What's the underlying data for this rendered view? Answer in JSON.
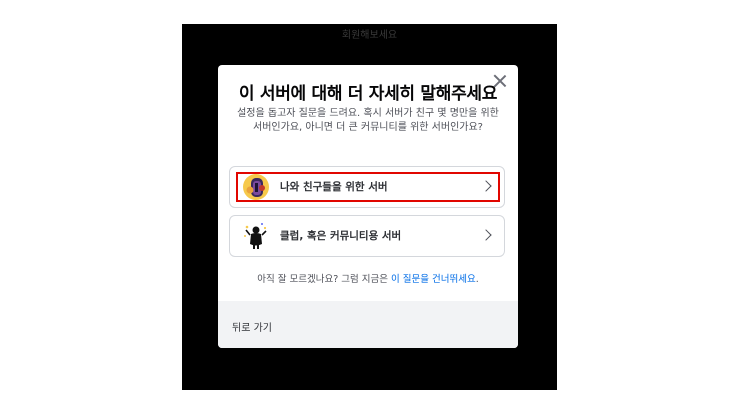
{
  "background": {
    "title": "회원해보세요"
  },
  "modal": {
    "title": "이 서버에 대해 더 자세히 말해주세요",
    "description": "설정을 돕고자 질문을 드려요. 혹시 서버가 친구 몇 명만을 위한 서버인가요, 아니면 더 큰 커뮤니티를 위한 서버인가요?",
    "options": [
      {
        "label": "나와 친구들을 위한 서버",
        "icon": "friends-icon",
        "highlighted": true
      },
      {
        "label": "클럽, 혹은 커뮤니티용 서버",
        "icon": "community-icon",
        "highlighted": false
      }
    ],
    "skip_prefix": "아직 잘 모르겠나요? 그럼 지금은 ",
    "skip_link": "이 질문을 건너뛰세요",
    "skip_suffix": ".",
    "back_label": "뒤로 가기"
  },
  "colors": {
    "overlay": "#000000",
    "link": "#006ce7",
    "highlight_border": "#e10600",
    "footer_bg": "#f2f3f5"
  }
}
